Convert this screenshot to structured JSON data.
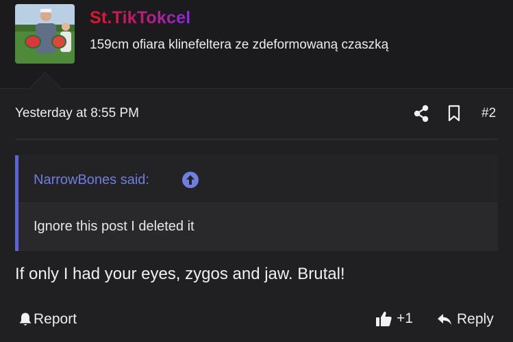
{
  "header": {
    "username": "St.TikTokcel",
    "user_title": "159cm ofiara klinefeltera ze zdeformowaną czaszką",
    "avatar_icon": "user-photo-avatar"
  },
  "meta": {
    "timestamp": "Yesterday at 8:55 PM",
    "post_number": "#2",
    "share_icon": "share-icon",
    "bookmark_icon": "bookmark-icon"
  },
  "quote": {
    "author_line": "NarrowBones said:",
    "arrow_icon": "arrow-up-circle-icon",
    "body": "Ignore this post I deleted it"
  },
  "message": {
    "text": "If only I had your eyes, zygos and jaw. Brutal!"
  },
  "footer": {
    "report_label": "Report",
    "like_count": "+1",
    "reply_label": "Reply"
  },
  "colors": {
    "background": "#202022",
    "header_background": "#1b1b1d",
    "quote_accent": "#5a67d3",
    "quote_author": "#6f7fe0",
    "username_gradient_start": "#e0162b",
    "username_gradient_end": "#8d2ad8"
  }
}
